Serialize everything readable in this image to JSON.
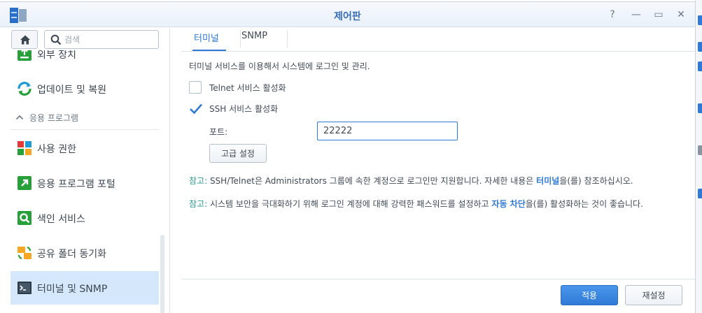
{
  "window": {
    "title": "제어판",
    "help_symbol": "?",
    "minimize_symbol": "—",
    "maximize_symbol": "▭",
    "close_symbol": "✕"
  },
  "sidebar": {
    "search_placeholder": "검색",
    "items": [
      {
        "label": "외부 장치",
        "icon": "external-device-icon"
      },
      {
        "label": "업데이트 및 복원",
        "icon": "update-restore-icon"
      },
      {
        "label": "사용 권한",
        "icon": "privileges-icon"
      },
      {
        "label": "응용 프로그램 포털",
        "icon": "application-portal-icon"
      },
      {
        "label": "색인 서비스",
        "icon": "indexing-service-icon"
      },
      {
        "label": "공유 폴더 동기화",
        "icon": "shared-folder-sync-icon"
      },
      {
        "label": "터미널 및 SNMP",
        "icon": "terminal-icon",
        "active": true
      }
    ],
    "section_label": "응용 프로그램"
  },
  "tabs": [
    {
      "label": "터미널",
      "active": true
    },
    {
      "label": "SNMP",
      "active": false
    }
  ],
  "content": {
    "description": "터미널 서비스를 이용해서 시스템에 로그인 및 관리.",
    "telnet_label": "Telnet 서비스 활성화",
    "telnet_checked": false,
    "ssh_label": "SSH 서비스 활성화",
    "ssh_checked": true,
    "port_label": "포트:",
    "port_value": "22222",
    "advanced_button": "고급 설정",
    "note1": {
      "key": "참고:",
      "text_before": " SSH/Telnet은 Administrators 그룹에 속한 계정으로 로그인만 지원합니다. 자세한 내용은 ",
      "link": "터미널",
      "text_after": "을(를) 참조하십시오."
    },
    "note2": {
      "key": "참고:",
      "text_before": " 시스템 보안을 극대화하기 위해 로그인 계정에 대해 강력한 패스워드를 설정하고 ",
      "link": "자동 차단",
      "text_after": "을(를) 활성화하는 것이 좋습니다."
    }
  },
  "footer": {
    "apply": "적용",
    "reset": "재설정"
  },
  "colors": {
    "accent": "#2e7ad6",
    "note_key": "#2e9b91",
    "active_item_bg": "#d5e7fb"
  }
}
